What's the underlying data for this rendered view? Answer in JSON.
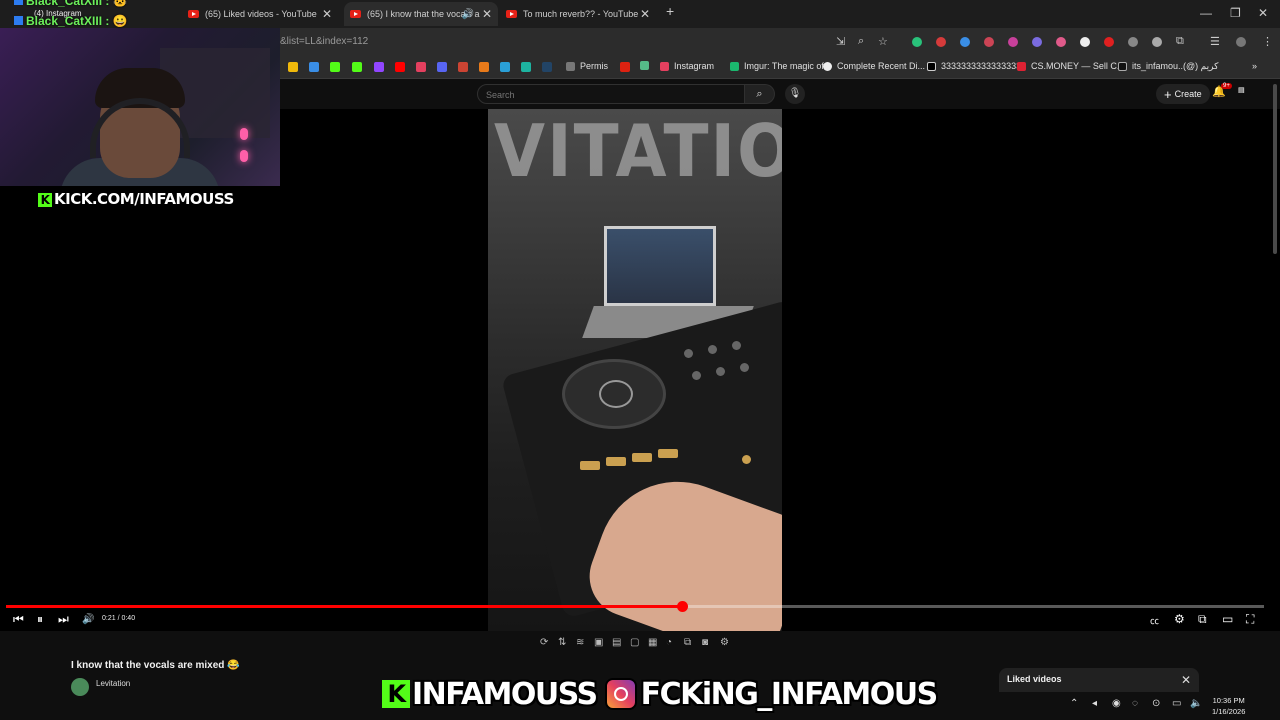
{
  "browser": {
    "tabs": [
      {
        "label": "(65) Liked videos - YouTube"
      },
      {
        "label": "(65) I know that the vocals a"
      },
      {
        "label": "To much reverb?? - YouTube"
      }
    ],
    "address_url": "&list=LL&index=112",
    "bookmarks": [
      {
        "label": "Permis"
      },
      {
        "label": "Instagram"
      },
      {
        "label": "Imgur: The magic of..."
      },
      {
        "label": "Complete Recent Di..."
      },
      {
        "label": "33333333333333333"
      },
      {
        "label": "CS.MONEY — Sell C..."
      },
      {
        "label": "its_infamou..(@) كريم"
      }
    ]
  },
  "youtube": {
    "search_placeholder": "Search",
    "create_label": "Create",
    "notif_count": "9+",
    "video_title": "I know that the vocals are mixed 😂",
    "channel_name": "Levitation",
    "time_display": "0:21 / 0:40",
    "progress_fraction": 0.537,
    "liked_panel_title": "Liked videos"
  },
  "overlay": {
    "chat": [
      {
        "user": "Black_CatXIII :"
      },
      {
        "user": "Black_CatXIII :"
      }
    ],
    "instagram_chip": "(4) Instagram",
    "kick_tag": "KICK.COM/INFAMOUSS",
    "banner_left": "INFAMOUSS",
    "banner_right": "FCKiNG_INFAMOUS",
    "wall_text": "VITATIO"
  },
  "taskbar": {
    "time": "10:36 PM",
    "date": "1/16/2026"
  },
  "colors": {
    "youtube_red": "#ff0000",
    "kick_green": "#53fc18",
    "background": "#0f0f0f"
  }
}
